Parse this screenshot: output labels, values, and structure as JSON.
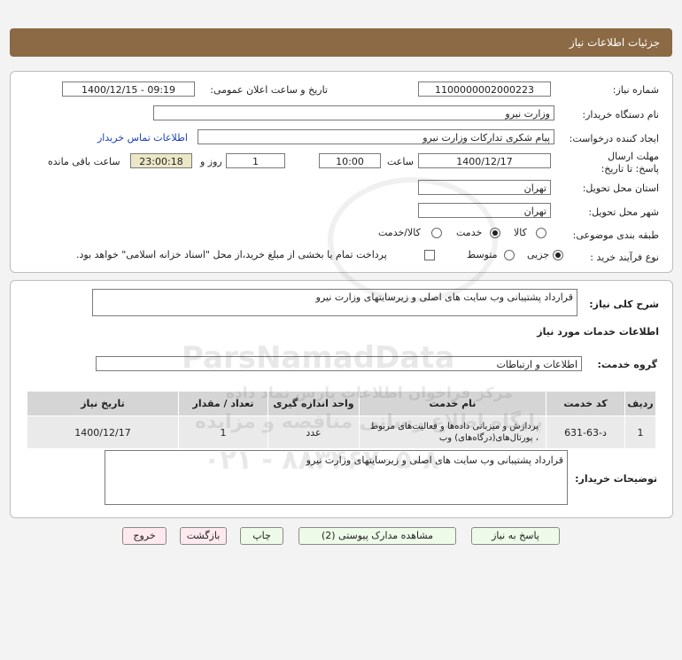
{
  "header": {
    "title": "جزئیات اطلاعات نیاز"
  },
  "form": {
    "need_number_label": "شماره نیاز:",
    "need_number": "1100000002000223",
    "announce_label": "تاریخ و ساعت اعلان عمومی:",
    "announce_value": "1400/12/15 - 09:19",
    "buyer_org_label": "نام دستگاه خریدار:",
    "buyer_org": "وزارت نیرو",
    "requester_label": "ایجاد کننده درخواست:",
    "requester": "پیام شکری تدارکات وزارت نیرو",
    "contact_link": "اطلاعات تماس خریدار",
    "deadline_label": "مهلت ارسال پاسخ: تا تاریخ:",
    "deadline_date": "1400/12/17",
    "time_label": "ساعت",
    "deadline_time": "10:00",
    "days_value": "1",
    "days_label": "روز و",
    "remaining_time": "23:00:18",
    "remaining_label": "ساعت باقی مانده",
    "province_label": "استان محل تحویل:",
    "province": "تهران",
    "city_label": "شهر محل تحویل:",
    "city": "تهران",
    "category_label": "طبقه بندی موضوعی:",
    "category_options": [
      "کالا",
      "خدمت",
      "کالا/خدمت"
    ],
    "category_selected": "خدمت",
    "process_label": "نوع فرآیند خرید :",
    "process_options": [
      "جزیی",
      "متوسط"
    ],
    "process_selected": "جزیی",
    "payment_note": "پرداخت تمام یا بخشی از مبلغ خرید،از محل \"اسناد خزانه اسلامی\" خواهد بود."
  },
  "summary": {
    "label": "شرح کلی نیاز:",
    "value": "قرارداد پشتیبانی وب سایت های اصلی و زیرسایتهای وزارت نیرو"
  },
  "services": {
    "section_title": "اطلاعات خدمات مورد نیاز",
    "group_label": "گروه خدمت:",
    "group_value": "اطلاعات و ارتباطات"
  },
  "table": {
    "headers": [
      "ردیف",
      "کد خدمت",
      "نام خدمت",
      "واحد اندازه گیری",
      "تعداد / مقدار",
      "تاریخ نیاز"
    ],
    "rows": [
      [
        "1",
        "د-63-631",
        "پردازش و میزبانی داده‌ها و فعالیت‌های مربوط ، پورتال‌های(درگاه‌های) وب",
        "عدد",
        "1",
        "1400/12/17"
      ]
    ]
  },
  "buyer_notes": {
    "label": "توضیحات خریدار:",
    "value": "قرارداد پشتیبانی وب سایت های اصلی و زیرسایتهای وزارت نیرو"
  },
  "buttons": {
    "reply": "پاسخ به نیاز",
    "view_docs": "مشاهده مدارک پیوستی (2)",
    "print": "چاپ",
    "back": "بازگشت",
    "exit": "خروج"
  },
  "watermark": {
    "brand": "ParsNamadData",
    "tagline": "مرکز فراخوان اطلاعات پارس نماد داده",
    "tagline2": "پایگاه اطلاع رسانی مناقصه و مزایده",
    "phone": "۰۲۱ - ۸۸۳۴۶۷۰۵-۸"
  },
  "colors": {
    "titlebar": "#8b6a45",
    "button_green": "#eefbe9",
    "button_pink": "#fde9ee",
    "link": "#1a3fb3"
  }
}
